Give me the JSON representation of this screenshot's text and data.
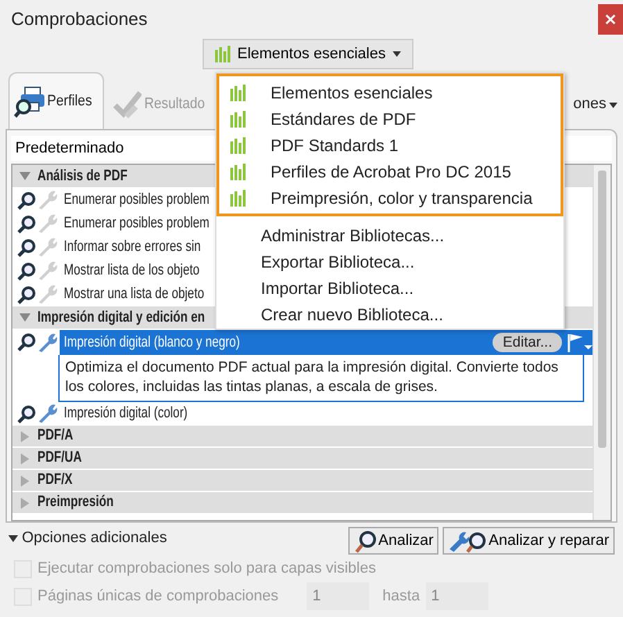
{
  "window": {
    "title": "Comprobaciones"
  },
  "library_button": {
    "label": "Elementos esenciales"
  },
  "tabs": [
    {
      "label": "Perfiles",
      "selected": true,
      "disabled": false,
      "kind": "profiles"
    },
    {
      "label": "Resultado",
      "selected": false,
      "disabled": true,
      "kind": "results"
    },
    {
      "label": "ones",
      "selected": false,
      "disabled": false,
      "kind": "menu"
    }
  ],
  "profile_field": {
    "value": "Predeterminado"
  },
  "tree": [
    {
      "label": "Análisis de PDF",
      "expanded": true,
      "children": [
        {
          "label": "Enumerar posibles problem",
          "selected": false,
          "fixup": false
        },
        {
          "label": "Enumerar posibles problem",
          "selected": false,
          "fixup": false
        },
        {
          "label": "Informar sobre errores sin",
          "selected": false,
          "fixup": false
        },
        {
          "label": "Mostrar lista de los objeto",
          "selected": false,
          "fixup": false
        },
        {
          "label": "Mostrar una lista de objeto",
          "selected": false,
          "fixup": false
        }
      ]
    },
    {
      "label": "Impresión digital y edición en",
      "expanded": true,
      "children": [
        {
          "label": "Impresión digital (blanco y negro)",
          "selected": true,
          "fixup": true,
          "edit_label": "Editar...",
          "description": "Optimiza el documento PDF actual para la impresión digital. Convierte todos los colores, incluidas las tintas planas, a escala de grises."
        },
        {
          "label": "Impresión digital (color)",
          "selected": false,
          "fixup": true
        }
      ]
    },
    {
      "label": "PDF/A",
      "expanded": false
    },
    {
      "label": "PDF/UA",
      "expanded": false
    },
    {
      "label": "PDF/X",
      "expanded": false
    },
    {
      "label": "Preimpresión",
      "expanded": false
    }
  ],
  "library_menu": {
    "libraries": [
      {
        "label": "Elementos esenciales"
      },
      {
        "label": "Estándares de PDF"
      },
      {
        "label": "PDF Standards 1"
      },
      {
        "label": "Perfiles de Acrobat Pro DC 2015"
      },
      {
        "label": "Preimpresión, color y transparencia"
      }
    ],
    "actions": [
      "Administrar Bibliotecas...",
      "Exportar Biblioteca...",
      "Importar Biblioteca...",
      "Crear nuevo Biblioteca..."
    ]
  },
  "options": {
    "label": "Opciones adicionales",
    "expanded": true,
    "checks": [
      {
        "label": "Ejecutar comprobaciones solo para capas visibles",
        "checked": false,
        "disabled": true
      },
      {
        "label": "Páginas únicas de comprobaciones",
        "checked": false,
        "disabled": true
      }
    ],
    "page_from": "1",
    "page_to_label": "hasta",
    "page_to": "1"
  },
  "buttons": [
    {
      "label": "Analizar",
      "kind": "analyze"
    },
    {
      "label": "Analizar y reparar",
      "kind": "fix"
    }
  ]
}
